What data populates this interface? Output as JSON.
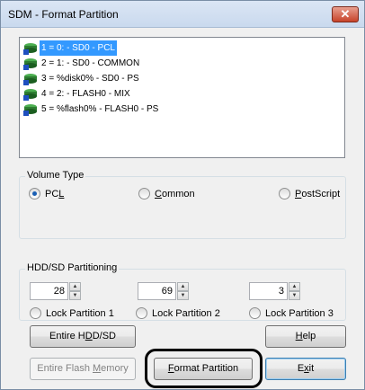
{
  "window": {
    "title": "SDM - Format Partition",
    "close_glyph": "✕"
  },
  "partitions": [
    {
      "label": "1 = 0: - SD0 - PCL",
      "selected": true,
      "icon": "drive-icon"
    },
    {
      "label": "2 = 1: - SD0 - COMMON",
      "selected": false,
      "icon": "drive-icon"
    },
    {
      "label": "3 = %disk0% - SD0 - PS",
      "selected": false,
      "icon": "drive-icon"
    },
    {
      "label": "4 = 2: - FLASH0 - MIX",
      "selected": false,
      "icon": "drive-icon"
    },
    {
      "label": "5 = %flash0% - FLASH0 - PS",
      "selected": false,
      "icon": "drive-icon"
    }
  ],
  "volume_type": {
    "legend": "Volume Type",
    "options": [
      {
        "label": "PCL",
        "mnemonic_prefix": "PC",
        "mnemonic": "L",
        "mnemonic_suffix": "",
        "checked": true
      },
      {
        "label": "Common",
        "mnemonic_prefix": "",
        "mnemonic": "C",
        "mnemonic_suffix": "ommon",
        "checked": false
      },
      {
        "label": "PostScript",
        "mnemonic_prefix": "",
        "mnemonic": "P",
        "mnemonic_suffix": "ostScript",
        "checked": false
      }
    ]
  },
  "partitioning": {
    "legend": "HDD/SD Partitioning",
    "spinners": [
      {
        "value": "28"
      },
      {
        "value": "69"
      },
      {
        "value": "3"
      }
    ],
    "locks": [
      {
        "label": "Lock Partition 1",
        "checked": false
      },
      {
        "label": "Lock Partition 2",
        "checked": false
      },
      {
        "label": "Lock Partition 3",
        "checked": false
      }
    ]
  },
  "buttons": {
    "entire_hdd": {
      "prefix": "Entire H",
      "mnemonic": "D",
      "suffix": "D/SD"
    },
    "help": {
      "prefix": "",
      "mnemonic": "H",
      "suffix": "elp"
    },
    "entire_flash": {
      "prefix": "Entire Flash ",
      "mnemonic": "M",
      "suffix": "emory"
    },
    "format": {
      "prefix": "",
      "mnemonic": "F",
      "suffix": "ormat Partition"
    },
    "exit": {
      "prefix": "E",
      "mnemonic": "x",
      "suffix": "it"
    }
  },
  "colors": {
    "selection": "#3399ff",
    "radio_dot": "#1a5fb4",
    "close_button": "#c7432a"
  }
}
